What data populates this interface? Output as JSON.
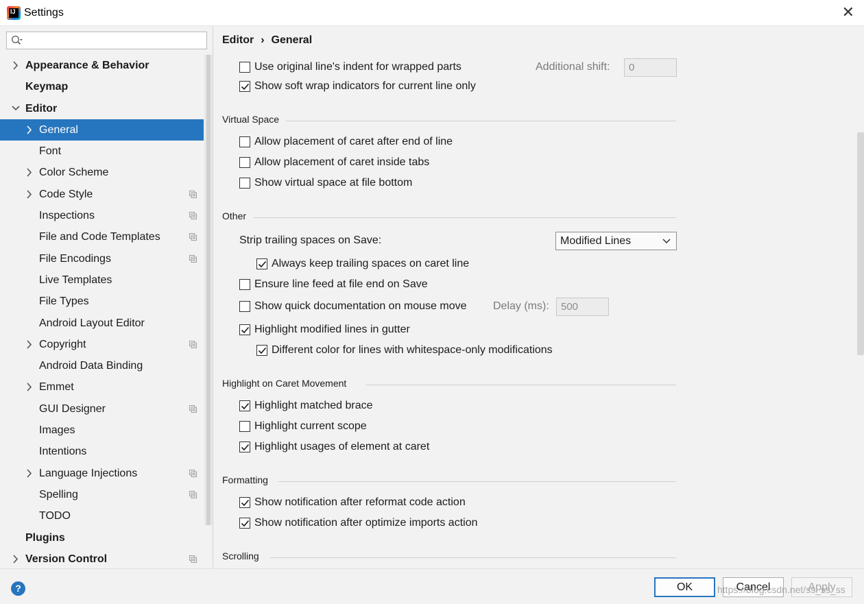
{
  "window": {
    "title": "Settings",
    "close_glyph": "✕"
  },
  "search": {
    "placeholder": "",
    "value": ""
  },
  "sidebar": {
    "items": [
      {
        "label": "Appearance & Behavior",
        "level": 0,
        "bold": true,
        "expandable": true,
        "expanded": false,
        "project": false
      },
      {
        "label": "Keymap",
        "level": 0,
        "bold": true,
        "expandable": false,
        "project": false
      },
      {
        "label": "Editor",
        "level": 0,
        "bold": true,
        "expandable": true,
        "expanded": true,
        "project": false
      },
      {
        "label": "General",
        "level": 1,
        "bold": false,
        "expandable": true,
        "expanded": false,
        "selected": true,
        "project": false
      },
      {
        "label": "Font",
        "level": 1,
        "bold": false,
        "expandable": false,
        "project": false
      },
      {
        "label": "Color Scheme",
        "level": 1,
        "bold": false,
        "expandable": true,
        "expanded": false,
        "project": false
      },
      {
        "label": "Code Style",
        "level": 1,
        "bold": false,
        "expandable": true,
        "expanded": false,
        "project": true
      },
      {
        "label": "Inspections",
        "level": 1,
        "bold": false,
        "expandable": false,
        "project": true
      },
      {
        "label": "File and Code Templates",
        "level": 1,
        "bold": false,
        "expandable": false,
        "project": true
      },
      {
        "label": "File Encodings",
        "level": 1,
        "bold": false,
        "expandable": false,
        "project": true
      },
      {
        "label": "Live Templates",
        "level": 1,
        "bold": false,
        "expandable": false,
        "project": false
      },
      {
        "label": "File Types",
        "level": 1,
        "bold": false,
        "expandable": false,
        "project": false
      },
      {
        "label": "Android Layout Editor",
        "level": 1,
        "bold": false,
        "expandable": false,
        "project": false
      },
      {
        "label": "Copyright",
        "level": 1,
        "bold": false,
        "expandable": true,
        "expanded": false,
        "project": true
      },
      {
        "label": "Android Data Binding",
        "level": 1,
        "bold": false,
        "expandable": false,
        "project": false
      },
      {
        "label": "Emmet",
        "level": 1,
        "bold": false,
        "expandable": true,
        "expanded": false,
        "project": false
      },
      {
        "label": "GUI Designer",
        "level": 1,
        "bold": false,
        "expandable": false,
        "project": true
      },
      {
        "label": "Images",
        "level": 1,
        "bold": false,
        "expandable": false,
        "project": false
      },
      {
        "label": "Intentions",
        "level": 1,
        "bold": false,
        "expandable": false,
        "project": false
      },
      {
        "label": "Language Injections",
        "level": 1,
        "bold": false,
        "expandable": true,
        "expanded": false,
        "project": true
      },
      {
        "label": "Spelling",
        "level": 1,
        "bold": false,
        "expandable": false,
        "project": true
      },
      {
        "label": "TODO",
        "level": 1,
        "bold": false,
        "expandable": false,
        "project": false
      },
      {
        "label": "Plugins",
        "level": 0,
        "bold": true,
        "expandable": false,
        "project": false
      },
      {
        "label": "Version Control",
        "level": 0,
        "bold": true,
        "expandable": true,
        "expanded": false,
        "project": true
      }
    ]
  },
  "breadcrumb": {
    "parent": "Editor",
    "separator": "›",
    "current": "General"
  },
  "softwrap": {
    "use_original_indent": {
      "label": "Use original line's indent for wrapped parts",
      "checked": false
    },
    "additional_shift_label": "Additional shift:",
    "additional_shift_value": "0",
    "show_indicators": {
      "label": "Show soft wrap indicators for current line only",
      "checked": true
    }
  },
  "virtual_space": {
    "title": "Virtual Space",
    "after_end": {
      "label": "Allow placement of caret after end of line",
      "checked": false
    },
    "inside_tabs": {
      "label": "Allow placement of caret inside tabs",
      "checked": false
    },
    "file_bottom": {
      "label": "Show virtual space at file bottom",
      "checked": false
    }
  },
  "other": {
    "title": "Other",
    "strip_label": "Strip trailing spaces on Save:",
    "strip_value": "Modified Lines",
    "keep_caret": {
      "label": "Always keep trailing spaces on caret line",
      "checked": true
    },
    "line_feed": {
      "label": "Ensure line feed at file end on Save",
      "checked": false
    },
    "quick_doc": {
      "label": "Show quick documentation on mouse move",
      "checked": false
    },
    "delay_label": "Delay (ms):",
    "delay_value": "500",
    "highlight_modified": {
      "label": "Highlight modified lines in gutter",
      "checked": true
    },
    "whitespace_color": {
      "label": "Different color for lines with whitespace-only modifications",
      "checked": true
    }
  },
  "caret_movement": {
    "title": "Highlight on Caret Movement",
    "matched_brace": {
      "label": "Highlight matched brace",
      "checked": true
    },
    "current_scope": {
      "label": "Highlight current scope",
      "checked": false
    },
    "usages": {
      "label": "Highlight usages of element at caret",
      "checked": true
    }
  },
  "formatting": {
    "title": "Formatting",
    "reformat": {
      "label": "Show notification after reformat code action",
      "checked": true
    },
    "optimize": {
      "label": "Show notification after optimize imports action",
      "checked": true
    }
  },
  "scrolling": {
    "title": "Scrolling"
  },
  "footer": {
    "help": "?",
    "ok": "OK",
    "cancel": "Cancel",
    "apply": "Apply",
    "watermark": "https://blog.csdn.net/ss_ss_ss"
  },
  "colors": {
    "selection": "#2675bf",
    "background": "#f2f2f2"
  }
}
